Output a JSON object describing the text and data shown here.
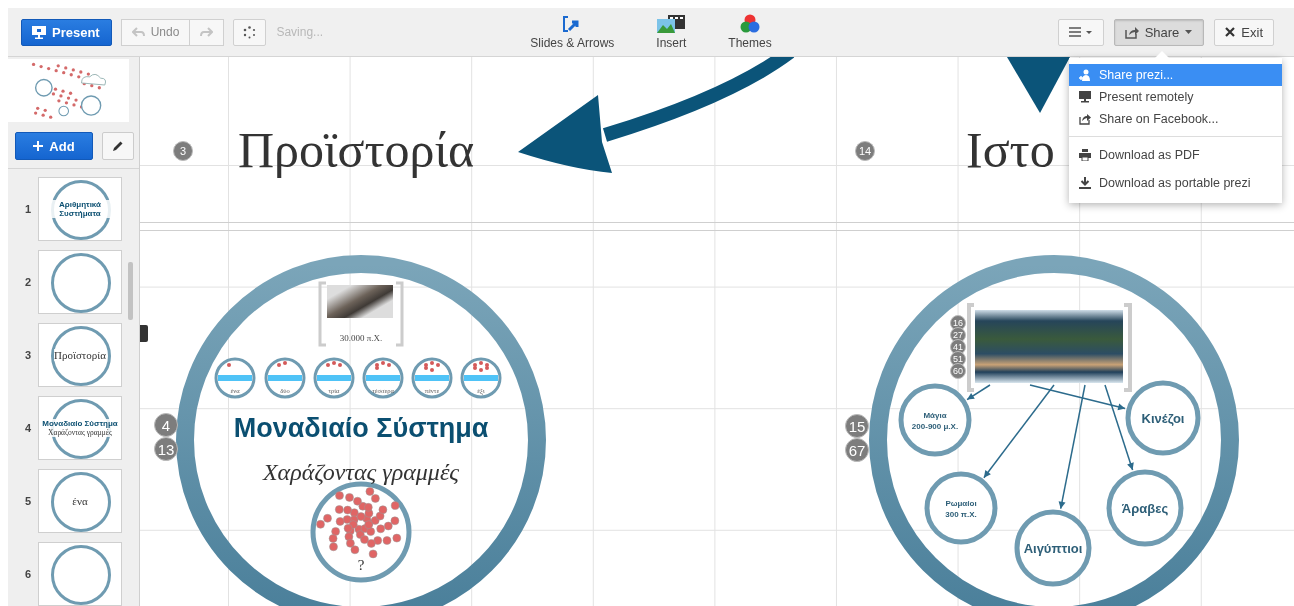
{
  "toolbar": {
    "present": "Present",
    "undo": "Undo",
    "status": "Saving...",
    "tools": [
      {
        "label": "Slides & Arrows"
      },
      {
        "label": "Insert"
      },
      {
        "label": "Themes"
      }
    ],
    "share": {
      "label": "Share",
      "expanded": true
    },
    "exit": "Exit"
  },
  "share_menu": {
    "groups": [
      {
        "items": [
          {
            "label": "Share prezi...",
            "selected": true
          },
          {
            "label": "Present remotely",
            "selected": false
          },
          {
            "label": "Share on Facebook...",
            "selected": false
          }
        ]
      },
      {
        "items": [
          {
            "label": "Download as PDF",
            "selected": false
          },
          {
            "label": "Download as portable prezi",
            "selected": false
          }
        ]
      }
    ]
  },
  "sidebar": {
    "add": "Add",
    "slides": [
      {
        "number": "1",
        "selected": false,
        "texts": [
          "Αριθμητικά Συστήματα"
        ]
      },
      {
        "number": "2",
        "selected": false
      },
      {
        "number": "3",
        "selected": false,
        "texts": [
          "Προϊστορία"
        ]
      },
      {
        "number": "4",
        "selected": false,
        "texts": [
          "Μοναδιαίο Σύστημα",
          "Χαράζοντας γραμμές"
        ]
      },
      {
        "number": "5",
        "selected": false,
        "texts": [
          "ένα"
        ]
      },
      {
        "number": "6",
        "selected": false
      }
    ]
  },
  "canvas": {
    "topics": [
      {
        "number": "3",
        "title": "Προϊστορία"
      },
      {
        "number": "14",
        "title": "Ιστο"
      }
    ],
    "unary_frame": {
      "badges": [
        "4",
        "13"
      ],
      "photo_caption": "30.000 π.Χ.",
      "steps": [
        "ένα",
        "δύο",
        "τρία",
        "τέσσερα",
        "πέντε",
        "έξι"
      ],
      "title": "Μοναδιαίο Σύστημα",
      "subtitle": "Χαράζοντας γραμμές",
      "question": "?"
    },
    "history_frame": {
      "map_badges": [
        "16",
        "27",
        "41",
        "51",
        "60"
      ],
      "badges": [
        "15",
        "67"
      ],
      "civilizations": [
        {
          "lines": [
            "Μάγια",
            "200-900 μ.Χ."
          ]
        },
        {
          "lines": [
            "Κινέζοι"
          ]
        },
        {
          "lines": [
            "Ρωμαίοι",
            "300 π.Χ."
          ]
        },
        {
          "lines": [
            "Αιγύπτιοι"
          ]
        },
        {
          "lines": [
            "Άραβες"
          ]
        }
      ]
    }
  }
}
